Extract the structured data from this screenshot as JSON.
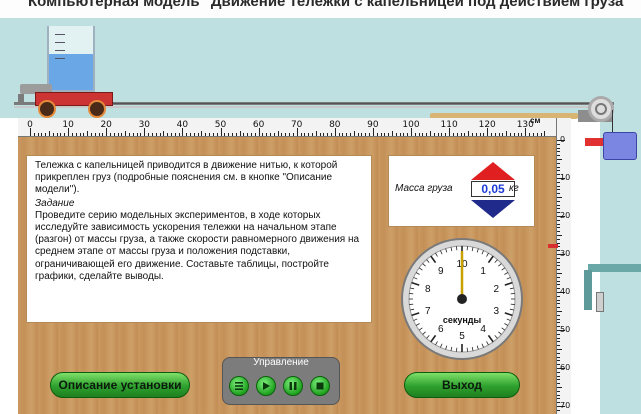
{
  "header": {
    "title": "Компьютерная модель \"Движение тележки с капельницей под действием груза\""
  },
  "ruler": {
    "labels": [
      "0",
      "10",
      "20",
      "30",
      "40",
      "50",
      "60",
      "70",
      "80",
      "90",
      "100",
      "110",
      "120",
      "130"
    ],
    "unit": "см"
  },
  "vruler": {
    "labels": [
      "0",
      "10",
      "20",
      "30",
      "40",
      "50",
      "60",
      "70"
    ]
  },
  "description": {
    "intro": "Тележка с капельницей приводится в движение нитью, к которой прикреплен груз (подробные пояснения см. в кнопке \"Описание модели\").",
    "task_title": "Задание",
    "task_text": "Проведите серию модельных экспериментов, в ходе которых исследуйте зависимость ускорения тележки на начальном этапе (разгон) от массы груза, а также скорости равномерного движения на среднем этапе от массы груза и положения подставки, ограничивающей его движение. Составьте таблицы, постройте графики, сделайте выводы."
  },
  "mass": {
    "label": "Масса груза",
    "value": "0,05",
    "unit": "кг"
  },
  "stopwatch": {
    "label": "секунды",
    "numbers": [
      "1",
      "2",
      "3",
      "4",
      "5",
      "6",
      "7",
      "8",
      "9",
      "10"
    ],
    "hand_value_seconds": 0
  },
  "controls": {
    "title": "Управление",
    "buttons": [
      "menu-icon",
      "play-icon",
      "pause-icon",
      "stop-icon"
    ]
  },
  "buttons": {
    "description": "Описание установки",
    "exit": "Выход"
  },
  "colors": {
    "background": "#bfe0e0",
    "panel": "#c99860",
    "accent_green": "#2ea12e",
    "mass_value": "#1b3bd8"
  }
}
